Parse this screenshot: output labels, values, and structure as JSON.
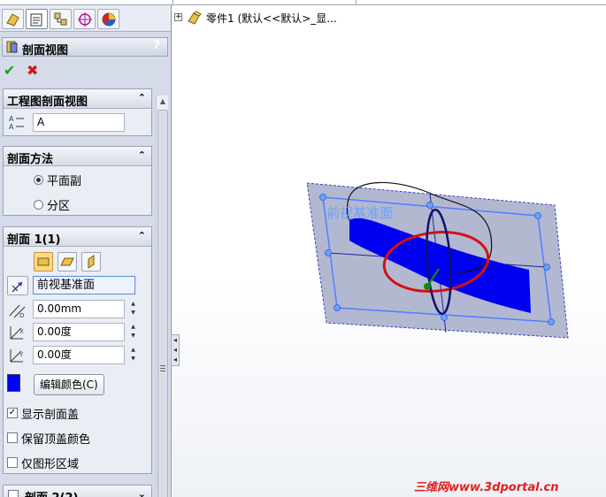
{
  "tabs": [
    "featuremanager-icon",
    "propertymanager-icon",
    "configuration-icon",
    "dimxpert-icon",
    "display-icon"
  ],
  "propertymanager": {
    "title": "剖面视图",
    "help": "?",
    "ok_icon": "✔",
    "cancel_icon": "✖"
  },
  "group_drawing": {
    "title": "工程图剖面视图",
    "chevron": "⌃",
    "name_value": "A"
  },
  "group_method": {
    "title": "剖面方法",
    "chevron": "⌃",
    "option_planar": "平面副",
    "option_zonal": "分区",
    "selected": "平面副"
  },
  "group_section1": {
    "title": "剖面 1(1)",
    "chevron": "⌃",
    "reference_value": "前视基准面",
    "offset_value": "0.00mm",
    "rotx_value": "0.00度",
    "roty_value": "0.00度",
    "edit_color_label": "编辑颜色(C)",
    "color": "#0000ff",
    "show_cap_label": "显示剖面盖",
    "show_cap_checked": true,
    "keep_color_label": "保留顶盖颜色",
    "keep_color_checked": false,
    "graphics_only_label": "仅图形区域",
    "graphics_only_checked": false
  },
  "group_section2": {
    "title": "剖面 2(2)",
    "chevron": "⌄",
    "checked": false
  },
  "tree": {
    "expander": "+",
    "label": "零件1 (默认<<默认>_显..."
  },
  "viewport": {
    "plane_label": "前视基准面",
    "plane_color": "#9fa6c8",
    "section_color": "#0000ff",
    "circle_color": "#d41010"
  },
  "watermark": "三维网www.3dportal.cn"
}
